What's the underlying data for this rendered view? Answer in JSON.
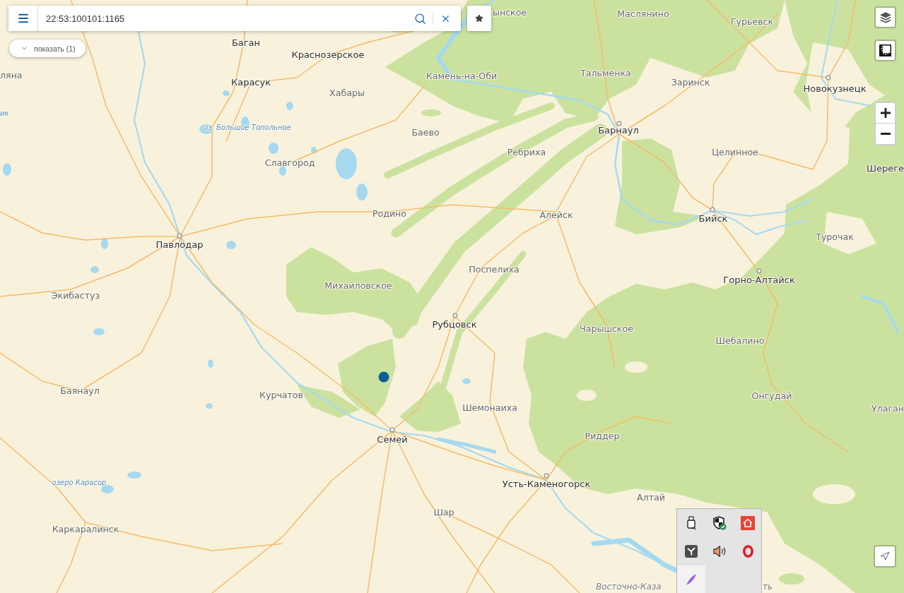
{
  "search": {
    "value": "22:53:100101:1165"
  },
  "show_button": {
    "label": "показать (1)"
  },
  "map": {
    "labels": [
      {
        "text": "ынское",
        "kind": "town"
      },
      {
        "text": "Маслянино",
        "kind": "town"
      },
      {
        "text": "Гурьевск",
        "kind": "town"
      },
      {
        "text": "Баган",
        "kind": "city"
      },
      {
        "text": "Краснозерское",
        "kind": "city"
      },
      {
        "text": "ляна",
        "kind": "town"
      },
      {
        "text": "Камень-на-Оби",
        "kind": "town"
      },
      {
        "text": "Тальменка",
        "kind": "town"
      },
      {
        "text": "Карасук",
        "kind": "city"
      },
      {
        "text": "Заринск",
        "kind": "town"
      },
      {
        "text": "Хабары",
        "kind": "town"
      },
      {
        "text": "Новокузнецк",
        "kind": "city"
      },
      {
        "text": "ик",
        "kind": "water"
      },
      {
        "text": "оз. Большое Топольное",
        "kind": "water"
      },
      {
        "text": "Баево",
        "kind": "town"
      },
      {
        "text": "Барнаул",
        "kind": "city"
      },
      {
        "text": "Ребриха",
        "kind": "town"
      },
      {
        "text": "Целинное",
        "kind": "town"
      },
      {
        "text": "Славгород",
        "kind": "town"
      },
      {
        "text": "Шереге",
        "kind": "city"
      },
      {
        "text": "Родино",
        "kind": "town"
      },
      {
        "text": "Алейск",
        "kind": "town"
      },
      {
        "text": "Бийск",
        "kind": "city"
      },
      {
        "text": "Турочак",
        "kind": "town"
      },
      {
        "text": "Павлодар",
        "kind": "city"
      },
      {
        "text": "Поспелиха",
        "kind": "town"
      },
      {
        "text": "Михайловское",
        "kind": "town"
      },
      {
        "text": "Горно-Алтайск",
        "kind": "city"
      },
      {
        "text": "Экибастуз",
        "kind": "town"
      },
      {
        "text": "Рубцовск",
        "kind": "city"
      },
      {
        "text": "Чарышское",
        "kind": "town"
      },
      {
        "text": "Шебалино",
        "kind": "town"
      },
      {
        "text": "Баянаул",
        "kind": "town"
      },
      {
        "text": "Курчатов",
        "kind": "town"
      },
      {
        "text": "Онгудай",
        "kind": "town"
      },
      {
        "text": "Шемонаиха",
        "kind": "town"
      },
      {
        "text": "Улаган",
        "kind": "town"
      },
      {
        "text": "Семей",
        "kind": "city"
      },
      {
        "text": "Риддер",
        "kind": "town"
      },
      {
        "text": "озеро Карасор",
        "kind": "water"
      },
      {
        "text": "Усть-Каменогорск",
        "kind": "city"
      },
      {
        "text": "Алтай",
        "kind": "town"
      },
      {
        "text": "Шар",
        "kind": "town"
      },
      {
        "text": "Каркаралинск",
        "kind": "town"
      },
      {
        "text": "Восточно-Каза",
        "kind": "region"
      },
      {
        "text": "ть",
        "kind": "region"
      }
    ]
  },
  "tray": {
    "items": [
      {
        "kind": "usb",
        "selected": false
      },
      {
        "kind": "shield",
        "selected": false
      },
      {
        "kind": "house",
        "selected": false
      },
      {
        "kind": "tile",
        "selected": false
      },
      {
        "kind": "speaker",
        "selected": false
      },
      {
        "kind": "ring",
        "selected": false
      },
      {
        "kind": "feather",
        "selected": true
      }
    ]
  }
}
